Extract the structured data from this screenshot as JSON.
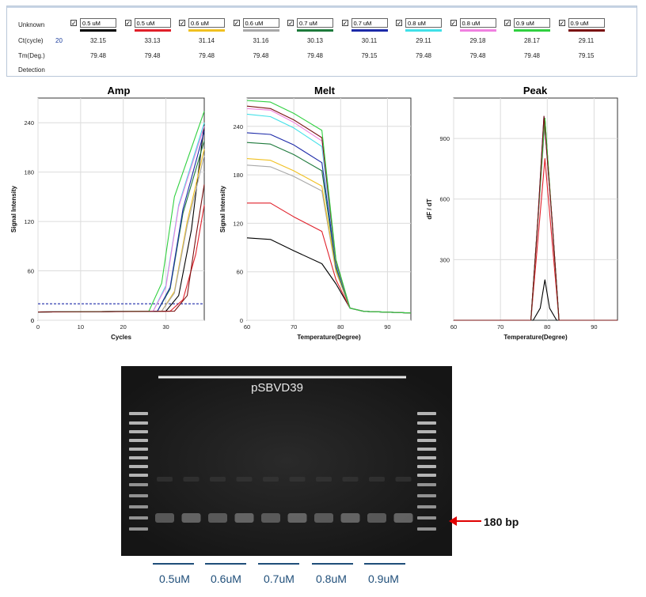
{
  "table": {
    "row_labels": {
      "unknown": "Unknown",
      "ct": "Ct(cycle)",
      "tm": "Tm(Deg.)",
      "detection": "Detection"
    },
    "ct_threshold": "20",
    "columns": [
      {
        "name": "0.5 uM",
        "color": "#000000",
        "ct": "32.15",
        "tm": "79.48"
      },
      {
        "name": "0.5 uM",
        "color": "#e0202a",
        "ct": "33.13",
        "tm": "79.48"
      },
      {
        "name": "0.6 uM",
        "color": "#f0c020",
        "ct": "31.14",
        "tm": "79.48"
      },
      {
        "name": "0.6 uM",
        "color": "#a8a8a8",
        "ct": "31.16",
        "tm": "79.48"
      },
      {
        "name": "0.7 uM",
        "color": "#1e7a3c",
        "ct": "30.13",
        "tm": "79.48"
      },
      {
        "name": "0.7 uM",
        "color": "#1c2aa8",
        "ct": "30.11",
        "tm": "79.15"
      },
      {
        "name": "0.8 uM",
        "color": "#40e0e8",
        "ct": "29.11",
        "tm": "79.48"
      },
      {
        "name": "0.8 uM",
        "color": "#f080e0",
        "ct": "29.18",
        "tm": "79.48"
      },
      {
        "name": "0.9 uM",
        "color": "#30d040",
        "ct": "28.17",
        "tm": "79.48"
      },
      {
        "name": "0.9 uM",
        "color": "#7a1010",
        "ct": "29.11",
        "tm": "79.15"
      }
    ]
  },
  "chart_data": [
    {
      "type": "line",
      "title": "Amp",
      "xlabel": "Cycles",
      "ylabel": "Signal Intensity",
      "xlim": [
        0,
        39
      ],
      "ylim": [
        0,
        270
      ],
      "xticks": [
        0,
        10,
        20,
        30
      ],
      "yticks": [
        0,
        60,
        120,
        180,
        240
      ],
      "threshold": 20,
      "grid": true,
      "series": [
        {
          "color": "#000000",
          "x": [
            0,
            30,
            33,
            36,
            39
          ],
          "y": [
            10,
            11,
            30,
            110,
            238
          ]
        },
        {
          "color": "#e0202a",
          "x": [
            0,
            31,
            34,
            37,
            39
          ],
          "y": [
            10,
            11,
            25,
            80,
            140
          ]
        },
        {
          "color": "#f0c020",
          "x": [
            0,
            29,
            32,
            35,
            39
          ],
          "y": [
            10,
            11,
            35,
            120,
            208
          ]
        },
        {
          "color": "#a8a8a8",
          "x": [
            0,
            29,
            32,
            35,
            39
          ],
          "y": [
            10,
            11,
            33,
            115,
            200
          ]
        },
        {
          "color": "#1e7a3c",
          "x": [
            0,
            28,
            31,
            34,
            39
          ],
          "y": [
            10,
            11,
            38,
            130,
            218
          ]
        },
        {
          "color": "#1c2aa8",
          "x": [
            0,
            28,
            31,
            34,
            39
          ],
          "y": [
            10,
            11,
            40,
            135,
            230
          ]
        },
        {
          "color": "#40e0e8",
          "x": [
            0,
            27,
            30,
            33,
            39
          ],
          "y": [
            10,
            11,
            42,
            140,
            240
          ]
        },
        {
          "color": "#f080e0",
          "x": [
            0,
            27,
            30,
            33,
            39
          ],
          "y": [
            10,
            11,
            40,
            138,
            236
          ]
        },
        {
          "color": "#30d040",
          "x": [
            0,
            26,
            29,
            32,
            39
          ],
          "y": [
            10,
            11,
            45,
            150,
            254
          ]
        },
        {
          "color": "#7a1010",
          "x": [
            0,
            32,
            35,
            37,
            39
          ],
          "y": [
            10,
            11,
            30,
            100,
            165
          ]
        }
      ]
    },
    {
      "type": "line",
      "title": "Melt",
      "xlabel": "Temperature(Degree)",
      "ylabel": "Signal Intensity",
      "xlim": [
        60,
        95
      ],
      "ylim": [
        0,
        275
      ],
      "xticks": [
        60,
        70,
        80,
        90
      ],
      "yticks": [
        0,
        60,
        120,
        180,
        240
      ],
      "grid": true,
      "series": [
        {
          "color": "#000000",
          "x": [
            60,
            65,
            70,
            76,
            79,
            82,
            85,
            95
          ],
          "y": [
            102,
            100,
            86,
            70,
            45,
            15,
            11,
            9
          ]
        },
        {
          "color": "#e0202a",
          "x": [
            60,
            65,
            70,
            76,
            79,
            82,
            85,
            95
          ],
          "y": [
            145,
            145,
            128,
            110,
            50,
            15,
            11,
            9
          ]
        },
        {
          "color": "#a8a8a8",
          "x": [
            60,
            65,
            70,
            76,
            79,
            82,
            85,
            95
          ],
          "y": [
            192,
            190,
            178,
            160,
            60,
            15,
            11,
            9
          ]
        },
        {
          "color": "#f0c020",
          "x": [
            60,
            65,
            70,
            76,
            79,
            82,
            85,
            95
          ],
          "y": [
            200,
            198,
            185,
            166,
            62,
            15,
            11,
            9
          ]
        },
        {
          "color": "#1e7a3c",
          "x": [
            60,
            65,
            70,
            76,
            79,
            82,
            85,
            95
          ],
          "y": [
            220,
            218,
            205,
            185,
            65,
            15,
            11,
            9
          ]
        },
        {
          "color": "#1c2aa8",
          "x": [
            60,
            65,
            70,
            76,
            79,
            82,
            85,
            95
          ],
          "y": [
            232,
            230,
            217,
            195,
            68,
            15,
            11,
            9
          ]
        },
        {
          "color": "#40e0e8",
          "x": [
            60,
            65,
            70,
            76,
            79,
            82,
            85,
            95
          ],
          "y": [
            255,
            252,
            238,
            215,
            70,
            15,
            11,
            9
          ]
        },
        {
          "color": "#f080e0",
          "x": [
            60,
            65,
            70,
            76,
            79,
            82,
            85,
            95
          ],
          "y": [
            262,
            260,
            245,
            222,
            72,
            15,
            11,
            9
          ]
        },
        {
          "color": "#7a1010",
          "x": [
            60,
            65,
            70,
            76,
            79,
            82,
            85,
            95
          ],
          "y": [
            265,
            262,
            248,
            226,
            73,
            15,
            11,
            9
          ]
        },
        {
          "color": "#30d040",
          "x": [
            60,
            65,
            70,
            76,
            79,
            82,
            85,
            95
          ],
          "y": [
            272,
            270,
            256,
            235,
            75,
            15,
            11,
            9
          ]
        }
      ]
    },
    {
      "type": "line",
      "title": "Peak",
      "xlabel": "Temperature(Degree)",
      "ylabel": "dF / dT",
      "xlim": [
        60,
        95
      ],
      "ylim": [
        0,
        1100
      ],
      "xticks": [
        60,
        70,
        80,
        90
      ],
      "yticks": [
        300,
        600,
        900
      ],
      "grid": true,
      "series": [
        {
          "color": "#000000",
          "x": [
            60,
            77,
            78.5,
            79.5,
            80.5,
            82,
            95
          ],
          "y": [
            0,
            0,
            60,
            200,
            60,
            0,
            0
          ]
        },
        {
          "color": "#e0202a",
          "x": [
            60,
            76.5,
            78,
            79.5,
            81,
            82.5,
            95
          ],
          "y": [
            0,
            0,
            400,
            800,
            400,
            0,
            0
          ]
        },
        {
          "color": "#f0c020",
          "x": [
            60,
            76.5,
            78,
            79.5,
            81,
            82.5,
            95
          ],
          "y": [
            0,
            0,
            500,
            1000,
            500,
            0,
            0
          ]
        },
        {
          "color": "#a8a8a8",
          "x": [
            60,
            76.5,
            78,
            79.5,
            81,
            82.5,
            95
          ],
          "y": [
            0,
            0,
            490,
            980,
            490,
            0,
            0
          ]
        },
        {
          "color": "#1e7a3c",
          "x": [
            60,
            76.5,
            78,
            79.5,
            81,
            82.5,
            95
          ],
          "y": [
            0,
            0,
            500,
            1000,
            500,
            0,
            0
          ]
        },
        {
          "color": "#1c2aa8",
          "x": [
            60,
            76.5,
            78,
            79.3,
            81,
            82.5,
            95
          ],
          "y": [
            0,
            0,
            505,
            1010,
            505,
            0,
            0
          ]
        },
        {
          "color": "#40e0e8",
          "x": [
            60,
            76.5,
            78,
            79.5,
            81,
            82.5,
            95
          ],
          "y": [
            0,
            0,
            495,
            990,
            495,
            0,
            0
          ]
        },
        {
          "color": "#f080e0",
          "x": [
            60,
            76.5,
            78,
            79.5,
            81,
            82.5,
            95
          ],
          "y": [
            0,
            0,
            490,
            980,
            490,
            0,
            0
          ]
        },
        {
          "color": "#30d040",
          "x": [
            60,
            76.5,
            78,
            79.5,
            81,
            82.5,
            95
          ],
          "y": [
            0,
            0,
            500,
            1000,
            500,
            0,
            0
          ]
        },
        {
          "color": "#7a1010",
          "x": [
            60,
            76.5,
            78,
            79.3,
            81,
            82.5,
            95
          ],
          "y": [
            0,
            0,
            505,
            1010,
            505,
            0,
            0
          ]
        }
      ]
    }
  ],
  "gel": {
    "title": "pSBVD39",
    "band_label": "180 bp",
    "band_color": "#e00000",
    "lane_groups": [
      "0.5uM",
      "0.6uM",
      "0.7uM",
      "0.8uM",
      "0.9uM"
    ],
    "label_color": "#1f4e79"
  }
}
